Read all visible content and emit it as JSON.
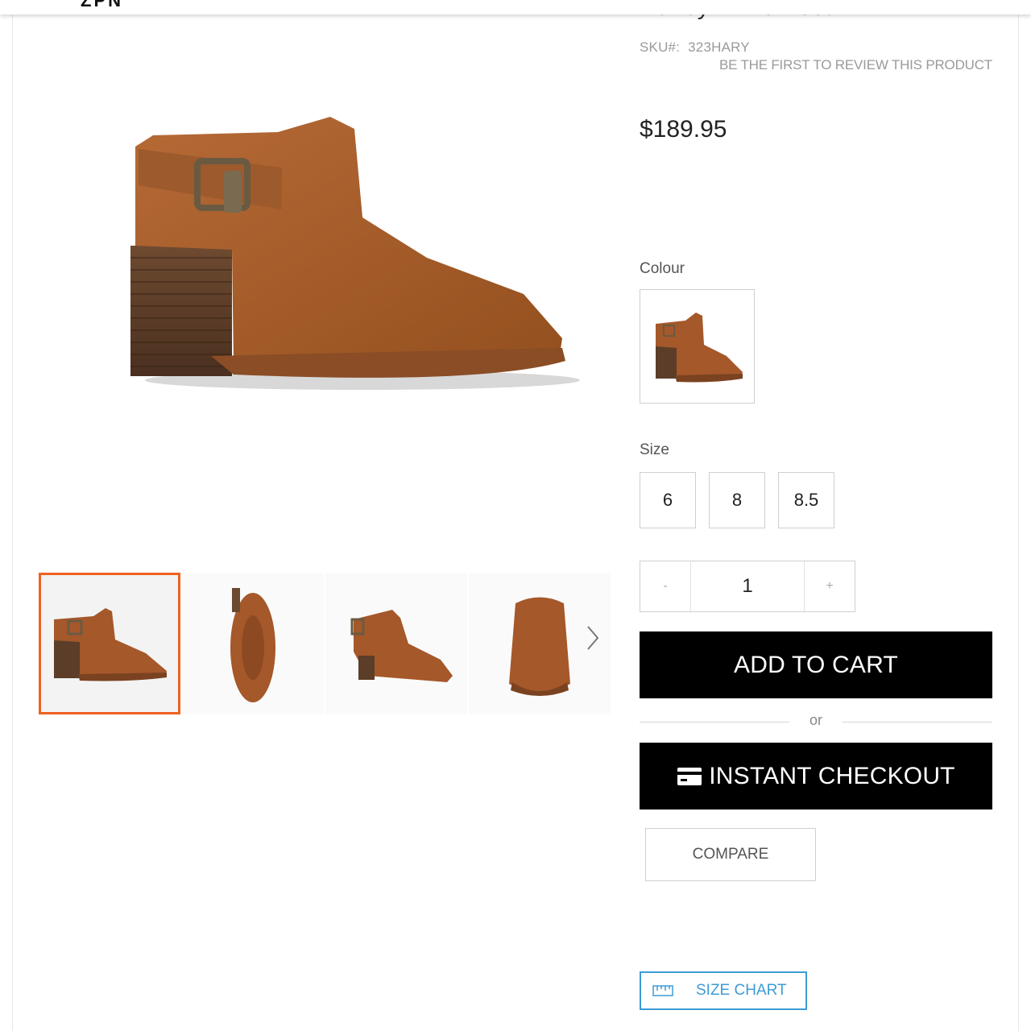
{
  "header": {
    "logo_text": "ZPN"
  },
  "product": {
    "title": "Harley Ankle Boot",
    "sku_label": "SKU#:",
    "sku_value": "323HARY",
    "review_link": "BE THE FIRST TO REVIEW THIS PRODUCT",
    "price": "$189.95"
  },
  "options": {
    "colour_label": "Colour",
    "size_label": "Size",
    "sizes": [
      "6",
      "8",
      "8.5"
    ]
  },
  "quantity": {
    "minus": "-",
    "value": "1",
    "plus": "+"
  },
  "actions": {
    "add_to_cart": "ADD TO CART",
    "or": "or",
    "instant_checkout": "INSTANT CHECKOUT",
    "compare": "COMPARE",
    "size_chart": "SIZE CHART"
  },
  "colors": {
    "leather": "#a5582a",
    "active_thumb_border": "#ef6220",
    "size_chart_accent": "#3d9bd6",
    "button_black": "#000000"
  },
  "icons": {
    "card": "credit-card-icon",
    "ruler": "ruler-icon",
    "next": "chevron-right-icon"
  }
}
